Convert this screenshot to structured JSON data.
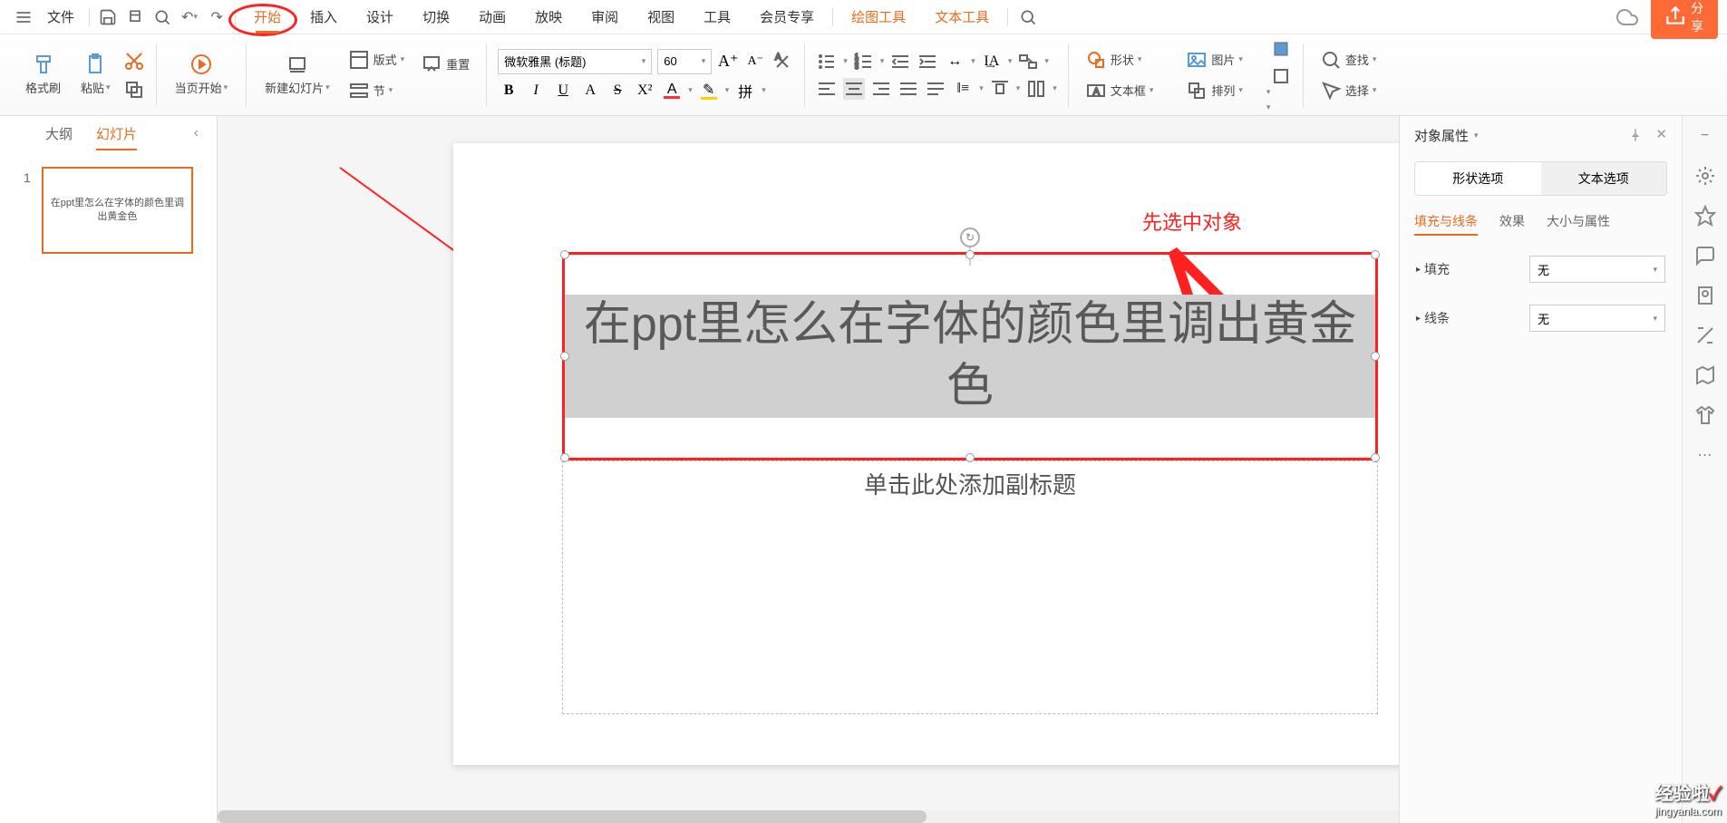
{
  "topbar": {
    "file": "文件",
    "tabs": [
      "开始",
      "插入",
      "设计",
      "切换",
      "动画",
      "放映",
      "审阅",
      "视图",
      "工具",
      "会员专享"
    ],
    "active_tab": "开始",
    "context_tabs": [
      "绘图工具",
      "文本工具"
    ],
    "share": "分享"
  },
  "ribbon": {
    "format_painter": "格式刷",
    "paste": "粘贴",
    "from_current": "当页开始",
    "new_slide": "新建幻灯片",
    "layout": "版式",
    "reset": "重置",
    "section": "节",
    "font_name": "微软雅黑 (标题)",
    "font_size": "60",
    "shape": "形状",
    "picture": "图片",
    "textbox": "文本框",
    "arrange": "排列",
    "find": "查找",
    "select": "选择"
  },
  "left": {
    "outline": "大纲",
    "slides": "幻灯片",
    "thumb_num": "1",
    "thumb_text": "在ppt里怎么在字体的颜色里调出黄金色"
  },
  "canvas": {
    "title": "在ppt里怎么在字体的颜色里调出黄金色",
    "subtitle": "单击此处添加副标题",
    "annot": "先选中对象"
  },
  "right": {
    "panel": "对象属性",
    "shape_opts": "形状选项",
    "text_opts": "文本选项",
    "fill_line": "填充与线条",
    "effects": "效果",
    "size_props": "大小与属性",
    "fill": "填充",
    "line": "线条",
    "none": "无"
  },
  "watermark": {
    "main": "经验啦",
    "sub": "jingyanla.com"
  }
}
